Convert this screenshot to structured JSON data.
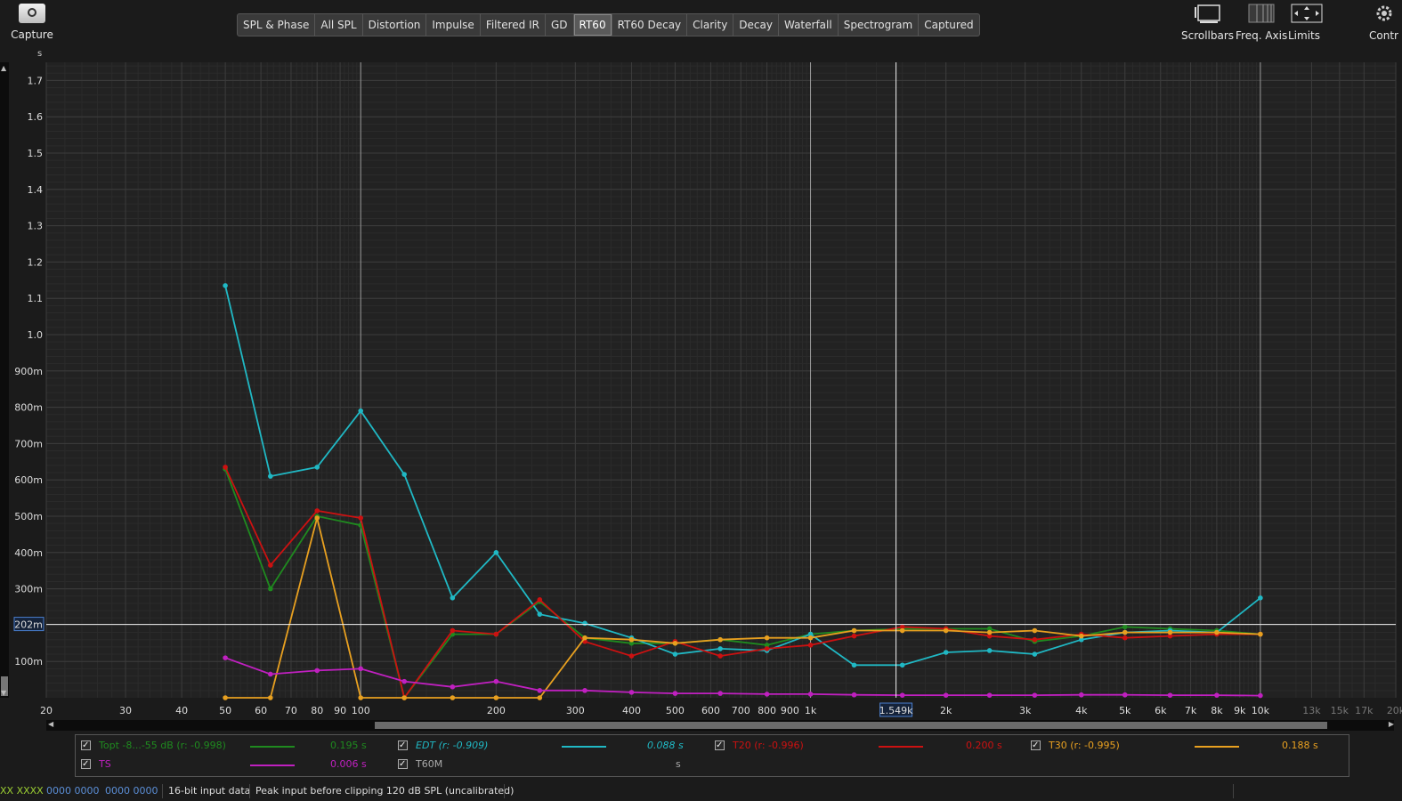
{
  "toolbar": {
    "capture_label": "Capture",
    "tabs": [
      "SPL & Phase",
      "All SPL",
      "Distortion",
      "Impulse",
      "Filtered IR",
      "GD",
      "RT60",
      "RT60 Decay",
      "Clarity",
      "Decay",
      "Waterfall",
      "Spectrogram",
      "Captured"
    ],
    "active_tab": "RT60",
    "right_tools": [
      "Scrollbars",
      "Freq. Axis",
      "Limits",
      "Contr"
    ]
  },
  "chart_data": {
    "type": "line",
    "ylabel": "s",
    "x_scale": "log",
    "xlim": [
      20,
      20000
    ],
    "ylim": [
      0,
      1.75
    ],
    "y_ticks": [
      {
        "v": 0.1,
        "label": "100m"
      },
      {
        "v": 0.3,
        "label": "300m"
      },
      {
        "v": 0.4,
        "label": "400m"
      },
      {
        "v": 0.5,
        "label": "500m"
      },
      {
        "v": 0.6,
        "label": "600m"
      },
      {
        "v": 0.7,
        "label": "700m"
      },
      {
        "v": 0.8,
        "label": "800m"
      },
      {
        "v": 0.9,
        "label": "900m"
      },
      {
        "v": 1.0,
        "label": "1.0"
      },
      {
        "v": 1.1,
        "label": "1.1"
      },
      {
        "v": 1.2,
        "label": "1.2"
      },
      {
        "v": 1.3,
        "label": "1.3"
      },
      {
        "v": 1.4,
        "label": "1.4"
      },
      {
        "v": 1.5,
        "label": "1.5"
      },
      {
        "v": 1.6,
        "label": "1.6"
      },
      {
        "v": 1.7,
        "label": "1.7"
      }
    ],
    "x_ticks": [
      {
        "v": 20,
        "label": "20"
      },
      {
        "v": 30,
        "label": "30"
      },
      {
        "v": 40,
        "label": "40"
      },
      {
        "v": 50,
        "label": "50"
      },
      {
        "v": 60,
        "label": "60"
      },
      {
        "v": 70,
        "label": "70"
      },
      {
        "v": 80,
        "label": "80"
      },
      {
        "v": 90,
        "label": "90"
      },
      {
        "v": 100,
        "label": "100"
      },
      {
        "v": 200,
        "label": "200"
      },
      {
        "v": 300,
        "label": "300"
      },
      {
        "v": 400,
        "label": "400"
      },
      {
        "v": 500,
        "label": "500"
      },
      {
        "v": 600,
        "label": "600"
      },
      {
        "v": 700,
        "label": "700"
      },
      {
        "v": 800,
        "label": "800"
      },
      {
        "v": 900,
        "label": "900"
      },
      {
        "v": 1000,
        "label": "1k"
      },
      {
        "v": 2000,
        "label": "2k"
      },
      {
        "v": 3000,
        "label": "3k"
      },
      {
        "v": 4000,
        "label": "4k"
      },
      {
        "v": 5000,
        "label": "5k"
      },
      {
        "v": 6000,
        "label": "6k"
      },
      {
        "v": 7000,
        "label": "7k"
      },
      {
        "v": 8000,
        "label": "8k"
      },
      {
        "v": 9000,
        "label": "9k"
      },
      {
        "v": 10000,
        "label": "10k"
      },
      {
        "v": 13000,
        "label": "13k",
        "dim": true
      },
      {
        "v": 15000,
        "label": "15k",
        "dim": true
      },
      {
        "v": 17000,
        "label": "17k",
        "dim": true
      },
      {
        "v": 20000,
        "label": "20k",
        "dim": true
      }
    ],
    "bold_x_lines": [
      100,
      1000,
      10000
    ],
    "x": [
      50,
      63,
      80,
      100,
      125,
      160,
      200,
      250,
      315,
      400,
      500,
      630,
      800,
      1000,
      1250,
      1600,
      2000,
      2500,
      3150,
      4000,
      5000,
      6300,
      8000,
      10000
    ],
    "series": [
      {
        "name": "Topt -8...-55 dB (r: -0.998)",
        "color": "#1f8a1f",
        "values": [
          0.63,
          0.3,
          0.5,
          0.475,
          0,
          0.175,
          0.175,
          0.265,
          0.165,
          0.15,
          0.15,
          0.16,
          0.145,
          0.175,
          0.185,
          0.19,
          0.19,
          0.19,
          0.155,
          0.17,
          0.195,
          0.19,
          0.185,
          0.175
        ]
      },
      {
        "name": "EDT (r: -0.909)",
        "color": "#20b8c4",
        "values": [
          1.135,
          0.61,
          0.635,
          0.79,
          0.615,
          0.275,
          0.4,
          0.23,
          0.205,
          0.165,
          0.12,
          0.135,
          0.13,
          0.175,
          0.09,
          0.09,
          0.125,
          0.13,
          0.12,
          0.16,
          0.18,
          0.185,
          0.18,
          0.275
        ]
      },
      {
        "name": "T20 (r: -0.996)",
        "color": "#cc1111",
        "values": [
          0.635,
          0.365,
          0.515,
          0.495,
          0,
          0.185,
          0.175,
          0.27,
          0.155,
          0.115,
          0.155,
          0.115,
          0.135,
          0.145,
          0.17,
          0.195,
          0.19,
          0.17,
          0.16,
          0.175,
          0.165,
          0.17,
          0.175,
          0.175
        ]
      },
      {
        "name": "T30 (r: -0.995)",
        "color": "#e8a020",
        "values": [
          0,
          0,
          0.495,
          0,
          0,
          0,
          0,
          0,
          0.165,
          0.16,
          0.15,
          0.16,
          0.165,
          0.165,
          0.185,
          0.185,
          0.185,
          0.18,
          0.185,
          0.17,
          0.18,
          0.18,
          0.18,
          0.175
        ]
      },
      {
        "name": "TS",
        "color": "#c020c0",
        "values": [
          0.11,
          0.065,
          0.075,
          0.08,
          0.045,
          0.03,
          0.045,
          0.02,
          0.02,
          0.015,
          0.012,
          0.012,
          0.01,
          0.01,
          0.008,
          0.007,
          0.007,
          0.007,
          0.007,
          0.008,
          0.008,
          0.007,
          0.007,
          0.006
        ]
      }
    ],
    "cursor": {
      "x_label": "1.549k",
      "x": 1549,
      "y_label": "202m",
      "y": 0.202
    }
  },
  "legend": {
    "topt": {
      "label": "Topt -8...-55 dB (r: -0.998)",
      "value": "0.195 s",
      "color": "#1f8a1f"
    },
    "edt": {
      "label": "EDT (r: -0.909)",
      "value": "0.088 s",
      "color": "#20b8c4"
    },
    "t20": {
      "label": "T20 (r: -0.996)",
      "value": "0.200 s",
      "color": "#cc1111"
    },
    "t30": {
      "label": "T30 (r: -0.995)",
      "value": "0.188 s",
      "color": "#e8a020"
    },
    "ts": {
      "label": "TS",
      "value": "0.006 s",
      "color": "#c020c0"
    },
    "t60m": {
      "label": "T60M",
      "value": "s",
      "color": "#aaaaaa"
    }
  },
  "status": {
    "level_a": "XX XXXX",
    "level_b": "0000 0000",
    "level_c": "0000 0000",
    "input_bits": "16-bit input data",
    "peak_text": "Peak input before clipping 120 dB SPL (uncalibrated)"
  }
}
